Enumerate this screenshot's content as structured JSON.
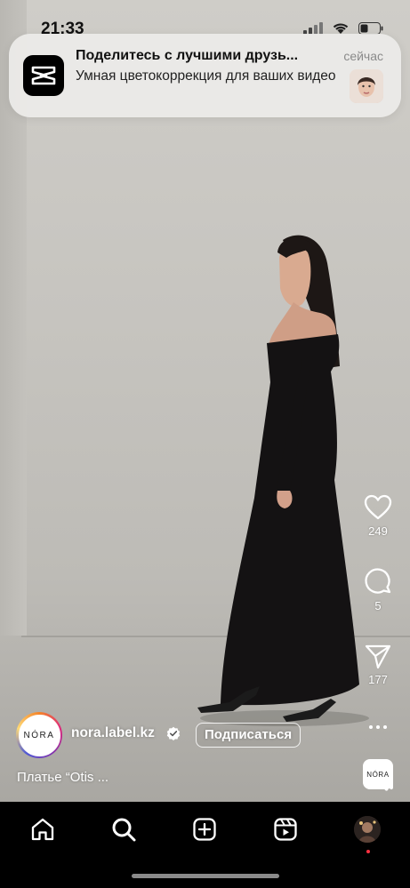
{
  "status_bar": {
    "time": "21:33"
  },
  "notification": {
    "app_icon": "capcut-icon",
    "title": "Поделитесь с лучшими друзь...",
    "body": "Умная цветокоррекция для ваших видео",
    "time": "сейчас"
  },
  "actions": {
    "likes": "249",
    "comments": "5",
    "shares": "177"
  },
  "post": {
    "avatar_text": "NÓRA",
    "username": "nora.label.kz",
    "follow_label": "Подписаться",
    "caption": "Платье “Otis ...",
    "audio_thumb_text": "NÓRA"
  },
  "nav": {
    "items": [
      "home-icon",
      "search-icon",
      "create-icon",
      "reels-icon",
      "profile-avatar"
    ]
  },
  "colors": {
    "notification_bg": "#ECEBE9",
    "nav_bg": "#000000",
    "badge_dot": "#FF3040"
  }
}
